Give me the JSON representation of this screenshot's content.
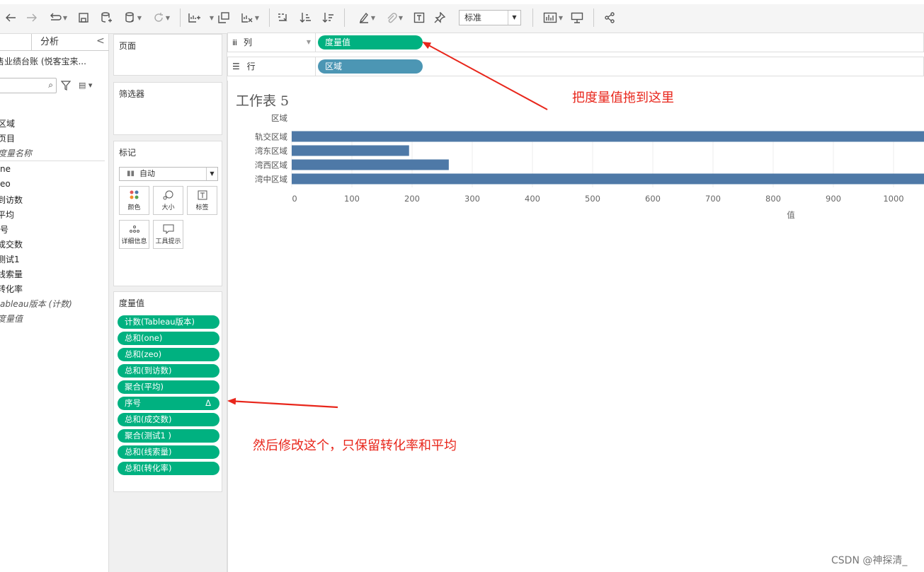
{
  "toolbar": {
    "std_select_value": "标准",
    "icons": [
      "back-arrow",
      "forward-arrow",
      "redo",
      "save",
      "new-datasource",
      "datasource-refresh",
      "auto-update",
      "new-worksheet",
      "duplicate-sheet",
      "clear-sheet",
      "swap",
      "sort-ascending",
      "sort-descending",
      "highlight",
      "group",
      "labels",
      "pin",
      "show-me",
      "presentation",
      "share"
    ]
  },
  "data_pane": {
    "tab_analysis": "分析",
    "datasource": "售业绩台账 (悦客宝来...",
    "dimensions": [
      "区域",
      "项目",
      "度量名称"
    ],
    "measures": [
      "one",
      "zeo",
      "到访数",
      "平均",
      "序号",
      "成交数",
      "测试1",
      "线索量",
      "转化率",
      "Tableau版本 (计数)",
      "度量值"
    ],
    "dimension_display": [
      "区域",
      "页目",
      "度量名称"
    ],
    "measure_display": [
      "ne",
      "eo",
      "到访数",
      "平均",
      "号",
      "成交数",
      "测试1",
      "线索量",
      "转化率",
      "ableau版本 (计数)",
      "度量值"
    ]
  },
  "cards": {
    "pages_title": "页面",
    "filters_title": "筛选器",
    "marks_title": "标记",
    "mark_type": "自动",
    "mark_buttons": [
      "颜色",
      "大小",
      "标签",
      "详细信息",
      "工具提示"
    ],
    "measure_values_title": "度量值",
    "measure_values": [
      "计数(Tableau版本)",
      "总和(one)",
      "总和(zeo)",
      "总和(到访数)",
      "聚合(平均)",
      "序号",
      "总和(成交数)",
      "聚合(测试1 )",
      "总和(线索量)",
      "总和(转化率)"
    ],
    "delta_symbol": "Δ"
  },
  "shelves": {
    "columns_label": "列",
    "rows_label": "行",
    "columns_pill": "度量值",
    "rows_pill": "区域"
  },
  "sheet": {
    "title": "工作表 5"
  },
  "chart_data": {
    "type": "bar",
    "orientation": "horizontal",
    "row_header": "区域",
    "categories": [
      "轨交区域",
      "湾东区域",
      "湾西区域",
      "湾中区域"
    ],
    "values": [
      1100,
      195,
      261,
      1100
    ],
    "xlabel": "值",
    "xlim": [
      0,
      1050
    ],
    "xticks": [
      0,
      100,
      200,
      300,
      400,
      500,
      600,
      700,
      800,
      900,
      1000
    ],
    "bar_color": "#4e79a7",
    "grid": true
  },
  "annotations": {
    "drag_hint": "把度量值拖到这里",
    "modify_hint": "然后修改这个，只保留转化率和平均",
    "color": "#e8261b"
  },
  "watermark": "CSDN @神探清_"
}
